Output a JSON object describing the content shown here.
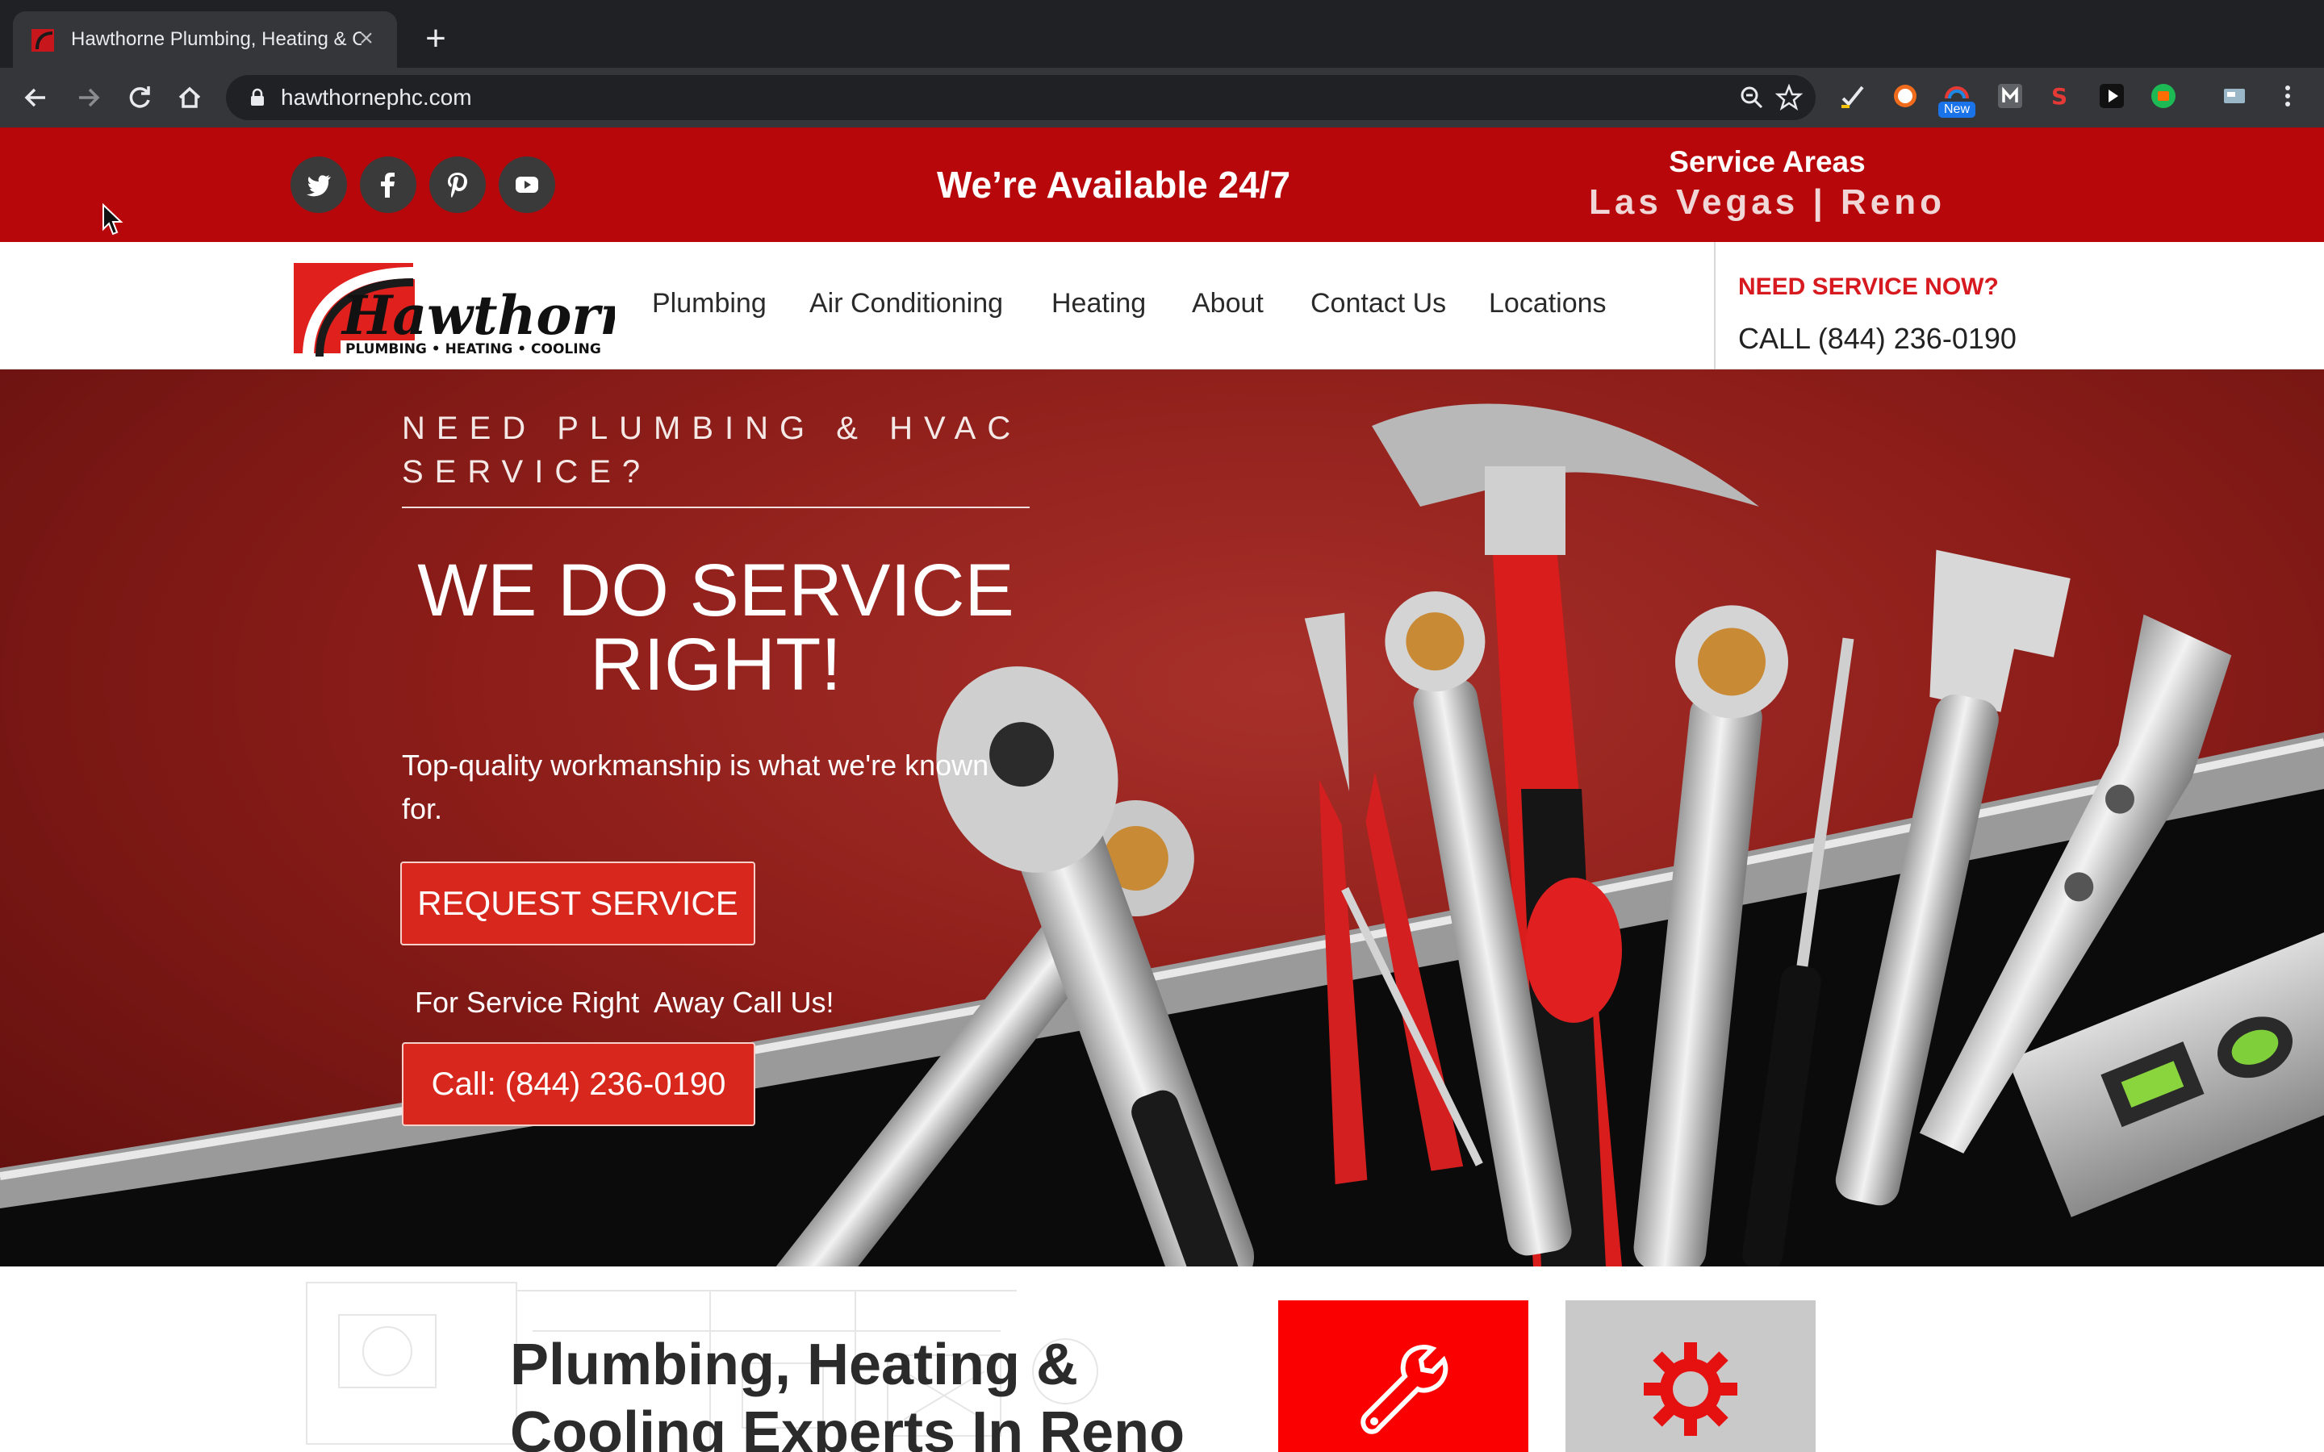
{
  "browser": {
    "tab_title": "Hawthorne Plumbing, Heating & Cooling",
    "tab_close": "×",
    "new_tab": "+",
    "url": "hawthornephc.com",
    "extension_badge": "New"
  },
  "topbar": {
    "social": [
      "twitter-icon",
      "facebook-icon",
      "pinterest-icon",
      "youtube-icon"
    ],
    "available": "We’re Available 24/7",
    "areas_title": "Service Areas",
    "areas_list": "Las Vegas | Reno"
  },
  "nav": {
    "items": [
      "Plumbing",
      "Air Conditioning",
      "Heating",
      "About",
      "Contact Us",
      "Locations"
    ],
    "need_now": "NEED SERVICE NOW?",
    "call": "CALL (844) 236-0190"
  },
  "logo": {
    "brand": "Hawthorne",
    "tagline": "PLUMBING • HEATING • COOLING"
  },
  "hero": {
    "kicker": "NEED PLUMBING & HVAC SERVICE?",
    "headline_1": "WE DO SERVICE",
    "headline_2": "RIGHT!",
    "subtext": "Top-quality workmanship is what we're known for.",
    "request_button": "REQUEST SERVICE",
    "call_note": "For Service Right  Away Call Us!",
    "call_button": "Call: (844) 236-0190"
  },
  "lower": {
    "title_1": "Plumbing, Heating &",
    "title_2": "Cooling Experts In Reno",
    "tiles": [
      "wrench-icon",
      "gear-icon"
    ]
  },
  "colors": {
    "brand_red": "#b8070a",
    "accent_red": "#d71a1f",
    "button_red": "#d8281d",
    "tile_red": "#fb0000",
    "tile_gray": "#c9c9c9"
  }
}
